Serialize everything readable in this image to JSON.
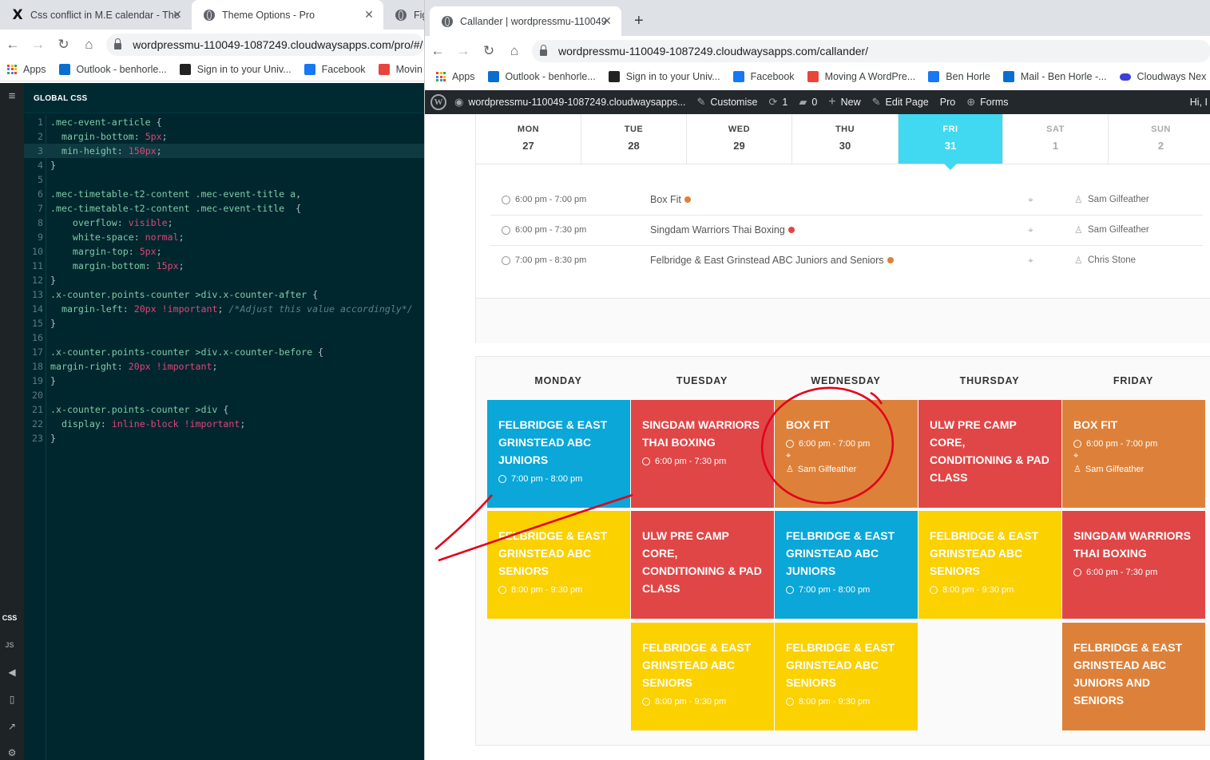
{
  "left_browser": {
    "tabs": [
      {
        "title": "Css conflict in M.E calendar - The",
        "icon": "x-theme-icon"
      },
      {
        "title": "Theme Options - Pro",
        "icon": "globe-icon"
      },
      {
        "title": "Fig",
        "icon": "globe-icon"
      }
    ],
    "url": "wordpressmu-110049-1087249.cloudwaysapps.com/pro/#/",
    "bookmarks": [
      "Apps",
      "Outlook - benhorle...",
      "Sign in to your Univ...",
      "Facebook",
      "Movin"
    ]
  },
  "editor": {
    "title": "GLOBAL CSS",
    "side_tabs": [
      "CSS",
      "JS"
    ],
    "lines": [
      ".mec-event-article {",
      "  margin-bottom: 5px;",
      "  min-height: 150px;",
      "}",
      "",
      ".mec-timetable-t2-content .mec-event-title a,",
      ".mec-timetable-t2-content .mec-event-title  {",
      "    overflow: visible;",
      "    white-space: normal;",
      "    margin-top: 5px;",
      "    margin-bottom: 15px;",
      "}",
      ".x-counter.points-counter >div.x-counter-after {",
      "  margin-left: 20px !important; /*Adjust this value accordingly*/",
      "}",
      "",
      ".x-counter.points-counter >div.x-counter-before {",
      "margin-right: 20px !important;",
      "}",
      "",
      ".x-counter.points-counter >div {",
      "  display: inline-block !important;",
      "}"
    ]
  },
  "right_browser": {
    "tab": {
      "title": "Callander | wordpressmu-110049",
      "icon": "globe-icon"
    },
    "new_tab": "+",
    "url": "wordpressmu-110049-1087249.cloudwaysapps.com/callander/",
    "bookmarks": [
      "Apps",
      "Outlook - benhorle...",
      "Sign in to your Univ...",
      "Facebook",
      "Moving A WordPre...",
      "Ben Horle",
      "Mail - Ben Horle -...",
      "Cloudways Nex"
    ],
    "admin_bar": {
      "site": "wordpressmu-110049-1087249.cloudwaysapps...",
      "customise": "Customise",
      "updates": "1",
      "comments": "0",
      "new": "New",
      "edit_page": "Edit Page",
      "pro": "Pro",
      "forms": "Forms",
      "greeting": "Hi, I"
    }
  },
  "week": {
    "days": [
      {
        "name": "MON",
        "date": "27",
        "state": "normal"
      },
      {
        "name": "TUE",
        "date": "28",
        "state": "normal"
      },
      {
        "name": "WED",
        "date": "29",
        "state": "normal"
      },
      {
        "name": "THU",
        "date": "30",
        "state": "normal"
      },
      {
        "name": "FRI",
        "date": "31",
        "state": "active"
      },
      {
        "name": "SAT",
        "date": "1",
        "state": "muted"
      },
      {
        "name": "SUN",
        "date": "2",
        "state": "muted"
      }
    ],
    "events": [
      {
        "time": "6:00 pm - 7:00 pm",
        "title": "Box Fit",
        "dot": "#dd813a",
        "organizer": "Sam Gilfeather"
      },
      {
        "time": "6:00 pm - 7:30 pm",
        "title": "Singdam Warriors Thai Boxing",
        "dot": "#e04646",
        "organizer": "Sam Gilfeather"
      },
      {
        "time": "7:00 pm - 8:30 pm",
        "title": "Felbridge & East Grinstead ABC Juniors and Seniors",
        "dot": "#dd813a",
        "organizer": "Chris Stone"
      }
    ]
  },
  "timetable": {
    "columns": [
      "MONDAY",
      "TUESDAY",
      "WEDNESDAY",
      "THURSDAY",
      "FRIDAY"
    ],
    "cards": [
      {
        "col": 0,
        "row": 0,
        "color": "blue",
        "title": "Felbridge & East Grinstead ABC Juniors",
        "time": "7:00 pm - 8:00 pm",
        "organizer": ""
      },
      {
        "col": 1,
        "row": 0,
        "color": "red",
        "title": "Singdam Warriors Thai Boxing",
        "time": "6:00 pm - 7:30 pm",
        "organizer": ""
      },
      {
        "col": 2,
        "row": 0,
        "color": "orange",
        "title": "Box Fit",
        "time": "6:00 pm - 7:00 pm",
        "organizer": "Sam Gilfeather"
      },
      {
        "col": 3,
        "row": 0,
        "color": "red",
        "title": "ULW Pre Camp Core, Conditioning & Pad Class",
        "time": "",
        "organizer": ""
      },
      {
        "col": 4,
        "row": 0,
        "color": "orange",
        "title": "Box Fit",
        "time": "6:00 pm - 7:00 pm",
        "organizer": "Sam Gilfeather"
      },
      {
        "col": 0,
        "row": 1,
        "color": "yellow",
        "title": "Felbridge & East Grinstead ABC Seniors",
        "time": "8:00 pm - 9:30 pm",
        "organizer": ""
      },
      {
        "col": 1,
        "row": 1,
        "color": "red",
        "title": "ULW Pre Camp Core, Conditioning & Pad Class",
        "time": "",
        "organizer": ""
      },
      {
        "col": 2,
        "row": 1,
        "color": "blue",
        "title": "Felbridge & East Grinstead ABC Juniors",
        "time": "7:00 pm - 8:00 pm",
        "organizer": ""
      },
      {
        "col": 3,
        "row": 1,
        "color": "yellow",
        "title": "Felbridge & East Grinstead ABC Seniors",
        "time": "8:00 pm - 9:30 pm",
        "organizer": ""
      },
      {
        "col": 4,
        "row": 1,
        "color": "red",
        "title": "Singdam Warriors Thai Boxing",
        "time": "6:00 pm - 7:30 pm",
        "organizer": ""
      },
      {
        "col": 1,
        "row": 2,
        "color": "yellow",
        "title": "Felbridge & East Grinstead ABC Seniors",
        "time": "8:00 pm - 9:30 pm",
        "organizer": ""
      },
      {
        "col": 2,
        "row": 2,
        "color": "yellow",
        "title": "Felbridge & East Grinstead ABC Seniors",
        "time": "8:00 pm - 9:30 pm",
        "organizer": ""
      },
      {
        "col": 4,
        "row": 2,
        "color": "orange",
        "title": "Felbridge & East Grinstead ABC Juniors and Seniors",
        "time": "",
        "organizer": ""
      }
    ]
  },
  "colors": {
    "active_day": "#40d9f1",
    "blue": "#0aa7d8",
    "red": "#e04646",
    "orange": "#dd813a",
    "yellow": "#fbd100",
    "annotation": "#e3001b"
  }
}
